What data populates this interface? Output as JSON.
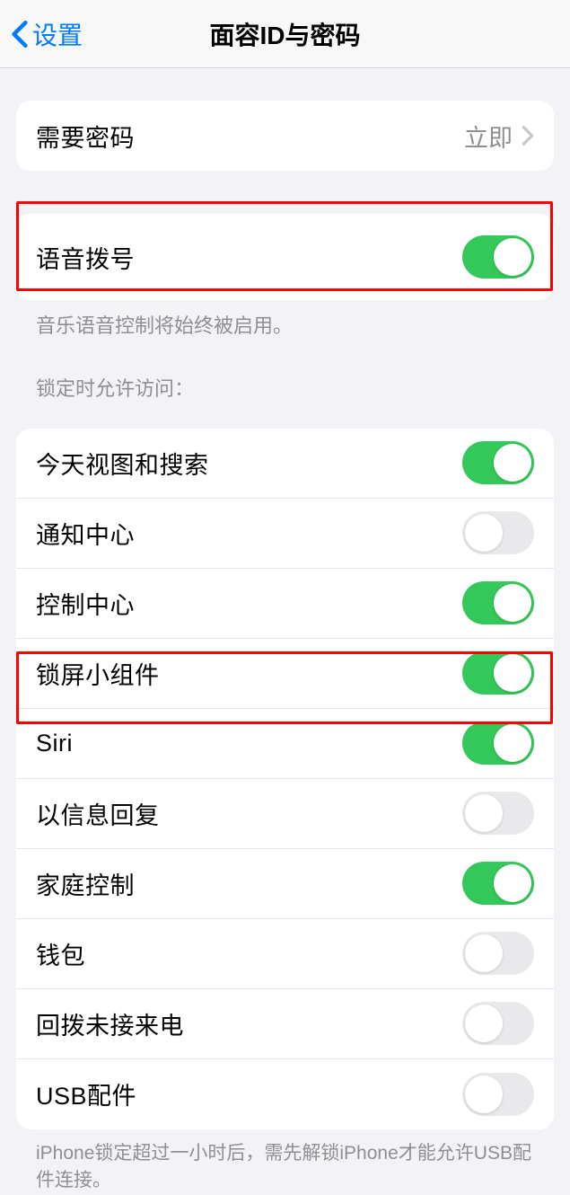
{
  "header": {
    "back": "设置",
    "title": "面容ID与密码"
  },
  "passcode_row": {
    "label": "需要密码",
    "value": "立即"
  },
  "voice_dial": {
    "label": "语音拨号",
    "on": true,
    "footer": "音乐语音控制将始终被启用。"
  },
  "lock_section_header": "锁定时允许访问：",
  "lock_items": [
    {
      "label": "今天视图和搜索",
      "on": true
    },
    {
      "label": "通知中心",
      "on": false
    },
    {
      "label": "控制中心",
      "on": true
    },
    {
      "label": "锁屏小组件",
      "on": true
    },
    {
      "label": "Siri",
      "on": true
    },
    {
      "label": "以信息回复",
      "on": false
    },
    {
      "label": "家庭控制",
      "on": true
    },
    {
      "label": "钱包",
      "on": false
    },
    {
      "label": "回拨未接来电",
      "on": false
    },
    {
      "label": "USB配件",
      "on": false
    }
  ],
  "usb_footer": "iPhone锁定超过一小时后，需先解锁iPhone才能允许USB配件连接。"
}
